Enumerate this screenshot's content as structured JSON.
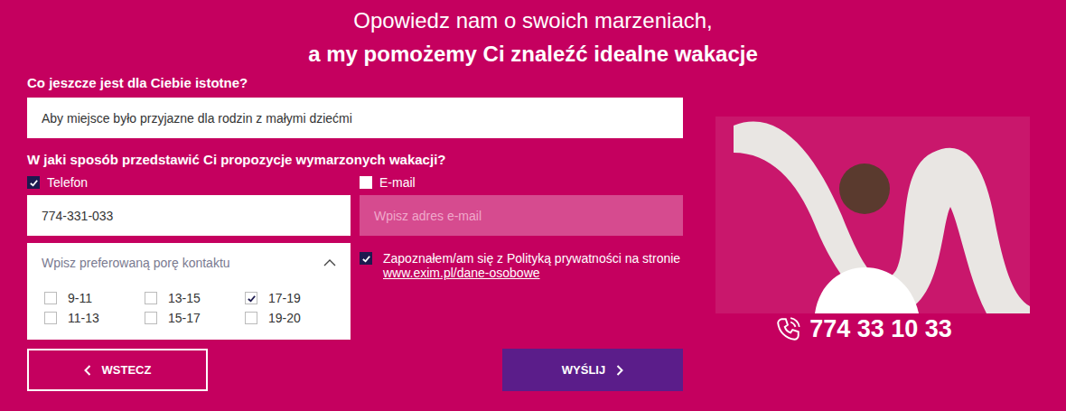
{
  "heading": {
    "line1": "Opowiedz nam o swoich marzeniach,",
    "line2": "a my pomożemy Ci znaleźć idealne wakacje"
  },
  "importance": {
    "label": "Co jeszcze jest dla Ciebie istotne?",
    "value": "Aby miejsce było przyjazne dla rodzin z małymi dziećmi"
  },
  "contact": {
    "label": "W jaki sposób przedstawić Ci propozycje wymarzonych wakacji?",
    "methods": [
      {
        "label": "Telefon",
        "checked": true,
        "value": "774-331-033",
        "placeholder": ""
      },
      {
        "label": "E-mail",
        "checked": false,
        "value": "",
        "placeholder": "Wpisz adres e-mail"
      }
    ]
  },
  "time": {
    "placeholder": "Wpisz preferowaną porę kontaktu",
    "expanded": true,
    "slots": [
      {
        "label": "9-11",
        "checked": false
      },
      {
        "label": "11-13",
        "checked": false
      },
      {
        "label": "13-15",
        "checked": false
      },
      {
        "label": "15-17",
        "checked": false
      },
      {
        "label": "17-19",
        "checked": true
      },
      {
        "label": "19-20",
        "checked": false
      }
    ]
  },
  "consent": {
    "checked": true,
    "text": "Zapoznałem/am się z Polityką prywatności na stronie",
    "link": "www.exim.pl/dane-osobowe"
  },
  "buttons": {
    "back": "WSTECZ",
    "send": "WYŚLIJ"
  },
  "phone": "774 33 10 33"
}
